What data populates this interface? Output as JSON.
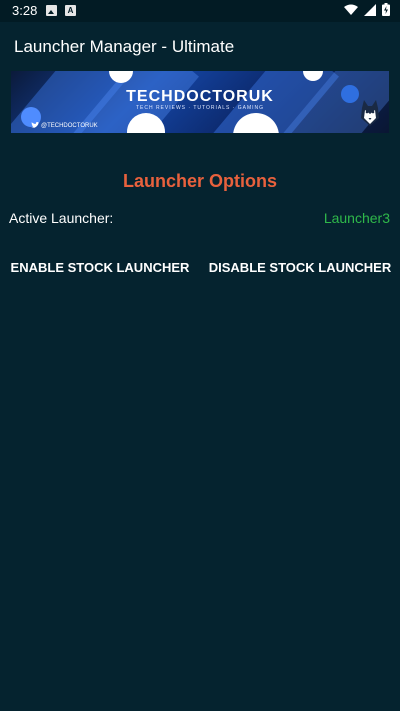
{
  "status_bar": {
    "time": "3:28",
    "left_icons": [
      "image-icon",
      "text-a-icon"
    ],
    "text_icon_letter": "A",
    "right_icons": [
      "wifi-icon",
      "cellular-icon",
      "battery-icon"
    ],
    "background": "#021b24"
  },
  "app_bar": {
    "title": "Launcher Manager - Ultimate"
  },
  "banner": {
    "title": "TECHDOCTORUK",
    "tagline": "TECH REVIEWS · TUTORIALS · GAMING",
    "handle": "@TECHDOCTORUK",
    "icons": [
      "twitter-icon",
      "husky-mascot-icon"
    ]
  },
  "main": {
    "section_title": "Launcher Options",
    "active_launcher_label": "Active Launcher:",
    "active_launcher_value": "Launcher3",
    "enable_button_label": "ENABLE STOCK LAUNCHER",
    "disable_button_label": "DISABLE STOCK LAUNCHER"
  },
  "colors": {
    "background": "#05232f",
    "accent_title": "#e8613d",
    "active_value": "#2fb84a",
    "text": "#ffffff"
  }
}
